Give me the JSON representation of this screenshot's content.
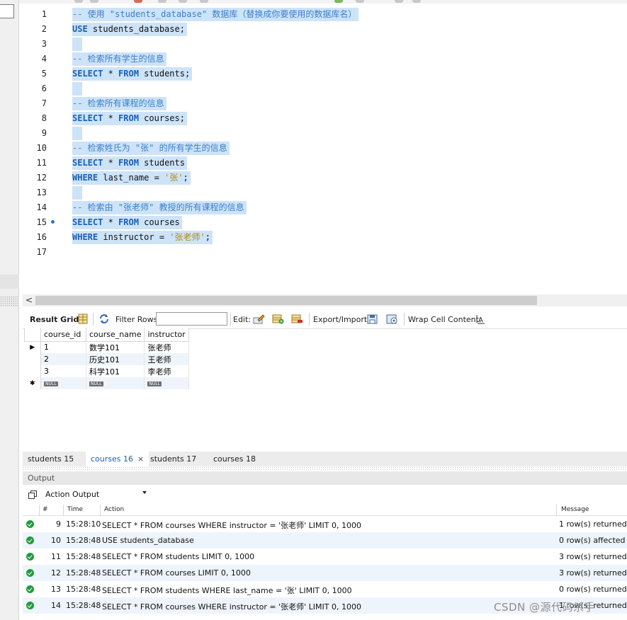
{
  "editor": {
    "lines": [
      {
        "n": "1",
        "tokens": [
          {
            "t": "comment",
            "v": "-- 使用 \"students_database\" 数据库（替换成你要使用的数据库名）"
          }
        ]
      },
      {
        "n": "2",
        "tokens": [
          {
            "t": "kw",
            "v": "USE"
          },
          {
            "t": "plain",
            "v": " students_database;"
          }
        ]
      },
      {
        "n": "3",
        "tokens": []
      },
      {
        "n": "4",
        "tokens": [
          {
            "t": "comment",
            "v": "-- 检索所有学生的信息"
          }
        ]
      },
      {
        "n": "5",
        "tokens": [
          {
            "t": "kw",
            "v": "SELECT"
          },
          {
            "t": "plain",
            "v": " * "
          },
          {
            "t": "kw",
            "v": "FROM"
          },
          {
            "t": "plain",
            "v": " students;"
          }
        ]
      },
      {
        "n": "6",
        "tokens": []
      },
      {
        "n": "7",
        "tokens": [
          {
            "t": "comment",
            "v": "-- 检索所有课程的信息"
          }
        ]
      },
      {
        "n": "8",
        "tokens": [
          {
            "t": "kw",
            "v": "SELECT"
          },
          {
            "t": "plain",
            "v": " * "
          },
          {
            "t": "kw",
            "v": "FROM"
          },
          {
            "t": "plain",
            "v": " courses;"
          }
        ]
      },
      {
        "n": "9",
        "tokens": []
      },
      {
        "n": "10",
        "tokens": [
          {
            "t": "comment",
            "v": "-- 检索姓氏为 \"张\" 的所有学生的信息"
          }
        ]
      },
      {
        "n": "11",
        "tokens": [
          {
            "t": "kw",
            "v": "SELECT"
          },
          {
            "t": "plain",
            "v": " * "
          },
          {
            "t": "kw",
            "v": "FROM"
          },
          {
            "t": "plain",
            "v": " students"
          }
        ]
      },
      {
        "n": "12",
        "tokens": [
          {
            "t": "kw",
            "v": "WHERE"
          },
          {
            "t": "plain",
            "v": " last_name = "
          },
          {
            "t": "str",
            "v": "'张'"
          },
          {
            "t": "plain",
            "v": ";"
          }
        ]
      },
      {
        "n": "13",
        "tokens": []
      },
      {
        "n": "14",
        "tokens": [
          {
            "t": "comment",
            "v": "-- 检索由 \"张老师\" 教授的所有课程的信息"
          }
        ]
      },
      {
        "n": "15",
        "breakpoint": true,
        "tokens": [
          {
            "t": "kw",
            "v": "SELECT"
          },
          {
            "t": "plain",
            "v": " * "
          },
          {
            "t": "kw",
            "v": "FROM"
          },
          {
            "t": "plain",
            "v": " courses"
          }
        ]
      },
      {
        "n": "16",
        "tokens": [
          {
            "t": "kw",
            "v": "WHERE"
          },
          {
            "t": "plain",
            "v": " instructor = "
          },
          {
            "t": "str",
            "v": "'张老师'"
          },
          {
            "t": "plain",
            "v": ";"
          }
        ]
      },
      {
        "n": "17",
        "tokens": [],
        "noHighlight": true
      }
    ]
  },
  "result_toolbar": {
    "result_grid": "Result Grid",
    "filter_rows": "Filter Rows:",
    "filter_value": "",
    "edit": "Edit:",
    "export_import": "Export/Import:",
    "wrap": "Wrap Cell Content:"
  },
  "grid": {
    "columns": [
      "course_id",
      "course_name",
      "instructor"
    ],
    "rows": [
      [
        "1",
        "数学101",
        "张老师"
      ],
      [
        "2",
        "历史101",
        "王老师"
      ],
      [
        "3",
        "科学101",
        "李老师"
      ]
    ],
    "null_label": "NULL"
  },
  "result_tabs": [
    {
      "label": "students 15",
      "active": false
    },
    {
      "label": "courses 16",
      "active": true,
      "close": "×"
    },
    {
      "label": "students 17",
      "active": false
    },
    {
      "label": "courses 18",
      "active": false
    }
  ],
  "output": {
    "title": "Output",
    "selector": "Action Output",
    "headers": {
      "num": "#",
      "time": "Time",
      "action": "Action",
      "message": "Message"
    },
    "rows": [
      {
        "num": "9",
        "time": "15:28:10",
        "action": "SELECT * FROM courses WHERE instructor = '张老师' LIMIT 0, 1000",
        "message": "1 row(s) returned"
      },
      {
        "num": "10",
        "time": "15:28:48",
        "action": "USE students_database",
        "message": "0 row(s) affected"
      },
      {
        "num": "11",
        "time": "15:28:48",
        "action": "SELECT * FROM students LIMIT 0, 1000",
        "message": "3 row(s) returned"
      },
      {
        "num": "12",
        "time": "15:28:48",
        "action": "SELECT * FROM courses LIMIT 0, 1000",
        "message": "3 row(s) returned"
      },
      {
        "num": "13",
        "time": "15:28:48",
        "action": "SELECT * FROM students WHERE last_name = '张' LIMIT 0, 1000",
        "message": "0 row(s) returned"
      },
      {
        "num": "14",
        "time": "15:28:48",
        "action": "SELECT * FROM courses WHERE instructor = '张老师' LIMIT 0, 1000",
        "message": "1 row(s) returned"
      }
    ]
  },
  "watermark": "CSDN @源代码杀手"
}
